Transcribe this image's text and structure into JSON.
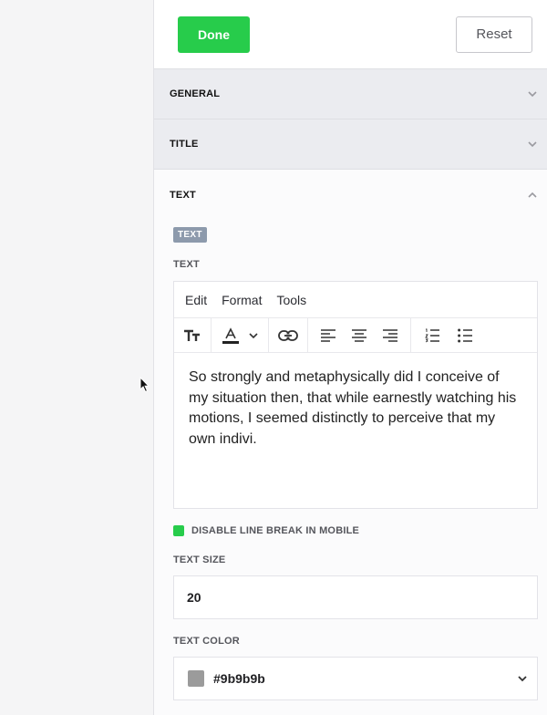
{
  "topbar": {
    "done_label": "Done",
    "reset_label": "Reset"
  },
  "sections": {
    "general": "GENERAL",
    "title": "TITLE",
    "text": "TEXT"
  },
  "text_section": {
    "badge": "TEXT",
    "field_label": "TEXT",
    "editor": {
      "menu": [
        "Edit",
        "Format",
        "Tools"
      ],
      "toolbar_icons": [
        "text-size-icon",
        "font-color-icon",
        "chevron-down-icon",
        "link-icon",
        "align-left-icon",
        "align-center-icon",
        "align-right-icon",
        "numbered-list-icon",
        "bullet-list-icon"
      ],
      "content": "So strongly and metaphysically did I conceive of my situation then, that while earnestly watching his motions, I seemed distinctly to perceive that my own indivi."
    },
    "disable_line_break_label": "DISABLE LINE BREAK IN MOBILE",
    "disable_line_break_checked": true,
    "text_size_label": "TEXT SIZE",
    "text_size_value": "20",
    "text_color_label": "TEXT COLOR",
    "text_color_value": "#9b9b9b"
  },
  "colors": {
    "accent": "#27cc4b",
    "badge": "#8d9aac",
    "swatch": "#9b9b9b"
  }
}
